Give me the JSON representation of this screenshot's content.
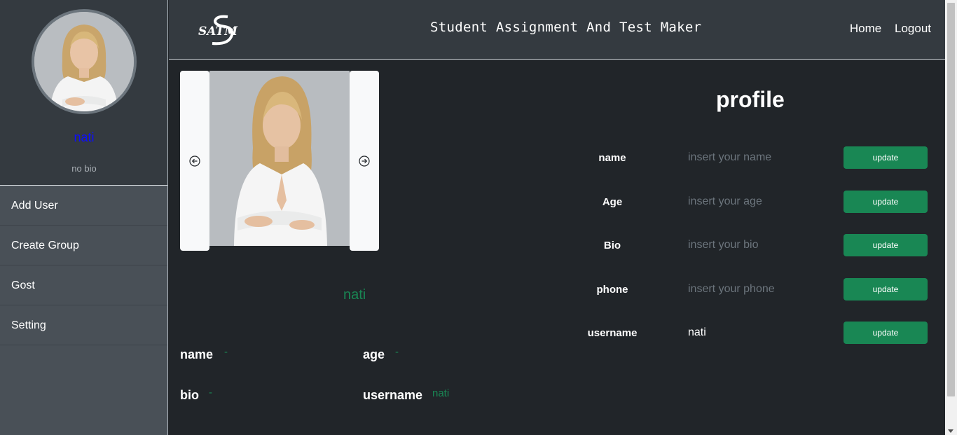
{
  "sidebar": {
    "username": "nati",
    "bio": "no bio",
    "menu": [
      {
        "label": "Add User"
      },
      {
        "label": "Create Group"
      },
      {
        "label": "Gost"
      },
      {
        "label": "Setting"
      }
    ]
  },
  "header": {
    "logo_text": "SATM",
    "title": "Student Assignment And Test Maker",
    "nav": {
      "home": "Home",
      "logout": "Logout"
    }
  },
  "profile_card": {
    "display_name": "nati",
    "fields": {
      "name_label": "name",
      "name_value": "-",
      "age_label": "age",
      "age_value": "-",
      "bio_label": "bio",
      "bio_value": "-",
      "username_label": "username",
      "username_value": "nati"
    }
  },
  "profile_form": {
    "title": "profile",
    "rows": [
      {
        "label": "name",
        "placeholder": "insert your name",
        "value": "",
        "button": "update"
      },
      {
        "label": "Age",
        "placeholder": "insert your age",
        "value": "",
        "button": "update"
      },
      {
        "label": "Bio",
        "placeholder": "insert your bio",
        "value": "",
        "button": "update"
      },
      {
        "label": "phone",
        "placeholder": "insert your phone",
        "value": "",
        "button": "update"
      },
      {
        "label": "username",
        "placeholder": "",
        "value": "nati",
        "button": "update"
      }
    ]
  },
  "colors": {
    "accent_green": "#198754",
    "sidebar_bg": "#495057",
    "header_bg": "#343a40",
    "main_bg": "#212529",
    "username_blue": "#0d0dff"
  }
}
